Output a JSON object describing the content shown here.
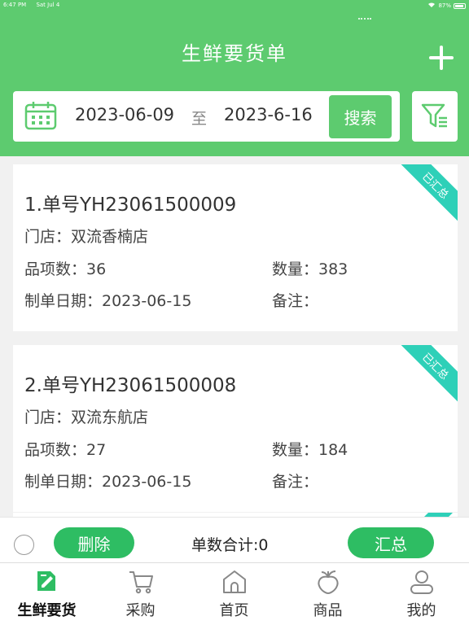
{
  "status": {
    "time": "6:47 PM",
    "date": "Sat Jul 4",
    "battery": "87%"
  },
  "header": {
    "title": "生鲜要货单"
  },
  "search": {
    "date_from": "2023-06-09",
    "separator": "至",
    "date_to": "2023-6-16",
    "button": "搜索"
  },
  "orders": [
    {
      "order_no": "1.单号YH23061500009",
      "store": "门店：双流香楠店",
      "items": "品项数：36",
      "qty": "数量：383",
      "date": "制单日期：2023-06-15",
      "note": "备注：",
      "badge": "已汇总"
    },
    {
      "order_no": "2.单号YH23061500008",
      "store": "门店：双流东航店",
      "items": "品项数：27",
      "qty": "数量：184",
      "date": "制单日期：2023-06-15",
      "note": "备注：",
      "badge": "已汇总"
    }
  ],
  "actions": {
    "delete": "删除",
    "total": "单数合计:0",
    "summarize": "汇总"
  },
  "tabs": [
    {
      "label": "生鲜要货",
      "icon": "fresh-order-icon",
      "active": true
    },
    {
      "label": "采购",
      "icon": "cart-icon"
    },
    {
      "label": "首页",
      "icon": "home-icon"
    },
    {
      "label": "商品",
      "icon": "produce-icon"
    },
    {
      "label": "我的",
      "icon": "user-icon"
    }
  ],
  "colors": {
    "brand": "#5dcb6f",
    "button": "#2ebd63",
    "badge": "#2ed0b8"
  }
}
